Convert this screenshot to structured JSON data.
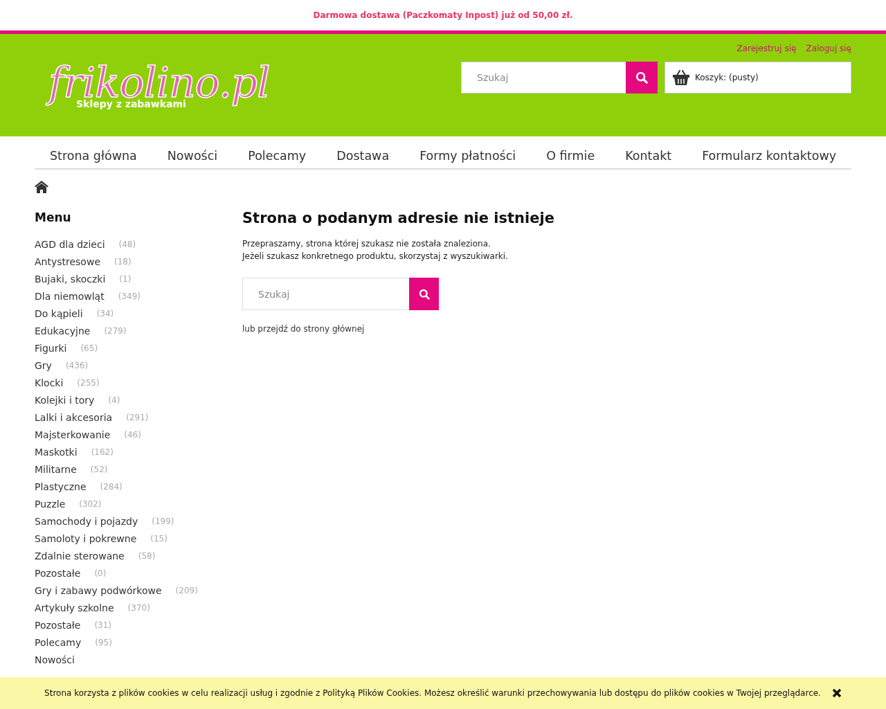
{
  "promo_bar": {
    "text": "Darmowa dostawa (Paczkomaty Inpost) już od 50,00 zł."
  },
  "header": {
    "account_links": [
      "Zarejestruj się",
      "Zaloguj się"
    ],
    "logo": {
      "name": "frikolino.pl",
      "tagline": "Sklepy z zabawkami"
    },
    "search": {
      "placeholder": "Szukaj"
    },
    "cart": {
      "label": "Koszyk: (pusty)"
    }
  },
  "nav": [
    "Strona główna",
    "Nowości",
    "Polecamy",
    "Dostawa",
    "Formy płatności",
    "O firmie",
    "Kontakt",
    "Formularz kontaktowy"
  ],
  "sidebar": {
    "title": "Menu",
    "items": [
      {
        "label": "AGD dla dzieci",
        "count": "(48)"
      },
      {
        "label": "Antystresowe",
        "count": "(18)"
      },
      {
        "label": "Bujaki, skoczki",
        "count": "(1)"
      },
      {
        "label": "Dla niemowląt",
        "count": "(349)"
      },
      {
        "label": "Do kąpieli",
        "count": "(34)"
      },
      {
        "label": "Edukacyjne",
        "count": "(279)"
      },
      {
        "label": "Figurki",
        "count": "(65)"
      },
      {
        "label": "Gry",
        "count": "(436)"
      },
      {
        "label": "Klocki",
        "count": "(255)"
      },
      {
        "label": "Kolejki i tory",
        "count": "(4)"
      },
      {
        "label": "Lalki i akcesoria",
        "count": "(291)"
      },
      {
        "label": "Majsterkowanie",
        "count": "(46)"
      },
      {
        "label": "Maskotki",
        "count": "(162)"
      },
      {
        "label": "Militarne",
        "count": "(52)"
      },
      {
        "label": "Plastyczne",
        "count": "(284)"
      },
      {
        "label": "Puzzle",
        "count": "(302)"
      },
      {
        "label": "Samochody i pojazdy",
        "count": "(199)"
      },
      {
        "label": "Samoloty i pokrewne",
        "count": "(15)"
      },
      {
        "label": "Zdalnie sterowane",
        "count": "(58)"
      },
      {
        "label": "Pozostałe",
        "count": "(0)"
      },
      {
        "label": "Gry i zabawy podwórkowe",
        "count": "(209)"
      },
      {
        "label": "Artykuły szkolne",
        "count": "(370)"
      },
      {
        "label": "Pozostałe",
        "count": "(31)"
      },
      {
        "label": "Polecamy",
        "count": "(95)"
      },
      {
        "label": "Nowości"
      }
    ]
  },
  "main": {
    "title": "Strona o podanym adresie nie istnieje",
    "message": [
      "Przepraszamy, strona której szukasz nie została znaleziona.",
      "Jeżeli szukasz konkretnego produktu, skorzystaj z wyszukiwarki."
    ],
    "search": {
      "placeholder": "Szukaj"
    },
    "home_link": "lub przejdź do strony głównej"
  },
  "cookie_bar": {
    "text": "Strona korzysta z plików cookies w celu realizacji usług i zgodnie z Polityką Plików Cookies. Możesz określić warunki przechowywania lub dostępu do plików cookies w Twojej przeglądarce."
  }
}
